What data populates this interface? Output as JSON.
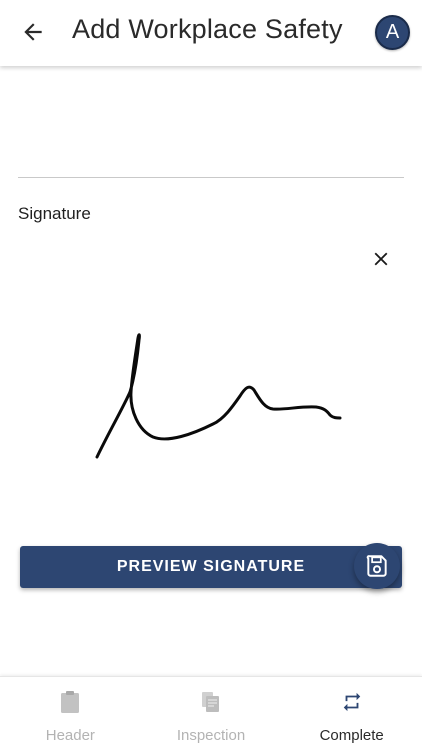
{
  "header": {
    "title": "Add Workplace Safety",
    "avatar_initial": "A"
  },
  "signature": {
    "label": "Signature",
    "preview_button_label": "PREVIEW SIGNATURE"
  },
  "bottom_nav": {
    "items": [
      {
        "label": "Header",
        "icon": "clipboard-icon",
        "active": false
      },
      {
        "label": "Inspection",
        "icon": "documents-icon",
        "active": false
      },
      {
        "label": "Complete",
        "icon": "repeat-arrows-icon",
        "active": true
      }
    ]
  },
  "colors": {
    "primary": "#2d4672",
    "inactive": "#b3b3b3",
    "text": "#2a2a2a"
  }
}
